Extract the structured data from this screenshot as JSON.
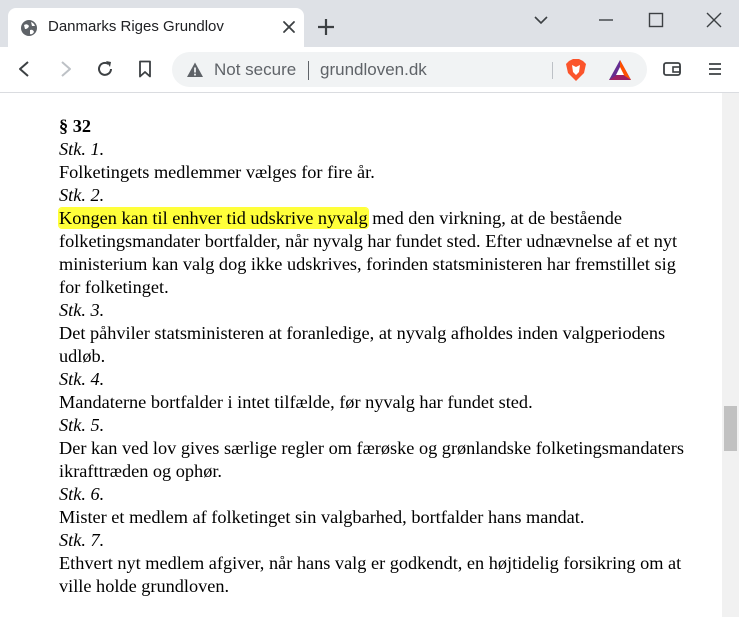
{
  "browser": {
    "tab_title": "Danmarks Riges Grundlov",
    "security_label": "Not secure",
    "url": "grundloven.dk"
  },
  "document": {
    "section": "§ 32",
    "subsections": [
      {
        "label": "Stk. 1.",
        "highlight": "",
        "text": "Folketingets medlemmer vælges for fire år."
      },
      {
        "label": "Stk. 2.",
        "highlight": "Kongen kan til enhver tid udskrive nyvalg",
        "text": " med den virkning, at de bestående folketingsmandater bortfalder, når nyvalg har fundet sted. Efter udnævnelse af et nyt ministerium kan valg dog ikke udskrives, forinden statsministeren har fremstillet sig for folketinget."
      },
      {
        "label": "Stk. 3.",
        "highlight": "",
        "text": "Det påhviler statsministeren at foranledige, at nyvalg afholdes inden valgperiodens udløb."
      },
      {
        "label": "Stk. 4.",
        "highlight": "",
        "text": "Mandaterne bortfalder i intet tilfælde, før nyvalg har fundet sted."
      },
      {
        "label": "Stk. 5.",
        "highlight": "",
        "text": "Der kan ved lov gives særlige regler om færøske og grønlandske folketingsmandaters ikrafttræden og ophør."
      },
      {
        "label": "Stk. 6.",
        "highlight": "",
        "text": "Mister et medlem af folketinget sin valgbarhed, bortfalder hans mandat."
      },
      {
        "label": "Stk. 7.",
        "highlight": "",
        "text": "Ethvert nyt medlem afgiver, når hans valg er godkendt, en højtidelig forsikring om at ville holde grundloven."
      }
    ],
    "highlight_color": "#ffff3a"
  },
  "icons": {
    "favicon": "globe-icon",
    "tab_close": "close-icon",
    "new_tab": "plus-icon",
    "back": "back-arrow-icon",
    "forward": "forward-arrow-icon",
    "reload": "reload-icon",
    "bookmark": "bookmark-icon",
    "warning": "warning-icon",
    "brave": "brave-shield-icon",
    "rewards": "bat-rewards-icon",
    "wallet": "wallet-icon",
    "menu": "menu-icon"
  }
}
